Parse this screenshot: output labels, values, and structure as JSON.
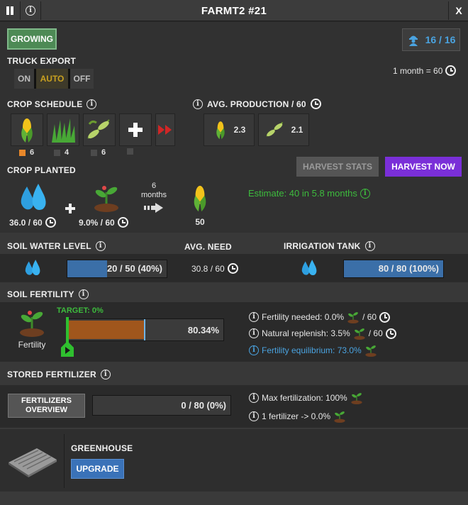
{
  "window": {
    "title": "FARMT2 #21",
    "close_label": "X"
  },
  "status": {
    "label": "GROWING"
  },
  "workers": {
    "value": "16 / 16"
  },
  "truck_export": {
    "label": "TRUCK EXPORT",
    "options": [
      "ON",
      "AUTO",
      "OFF"
    ],
    "selected": "AUTO"
  },
  "time_scale": {
    "text": "1 month = 60"
  },
  "crop_schedule": {
    "label": "CROP SCHEDULE",
    "slots": [
      {
        "crop": "corn",
        "count": "6",
        "active": true
      },
      {
        "crop": "grass",
        "count": "4",
        "active": false
      },
      {
        "crop": "soybean",
        "count": "6",
        "active": false
      },
      {
        "crop": "add",
        "count": "",
        "active": false
      }
    ]
  },
  "avg_production": {
    "label": "AVG. PRODUCTION / 60",
    "items": [
      {
        "crop": "corn",
        "value": "2.3"
      },
      {
        "crop": "soybean",
        "value": "2.1"
      }
    ]
  },
  "crop_planted": {
    "label": "CROP PLANTED",
    "harvest_stats_label": "HARVEST STATS",
    "harvest_now_label": "HARVEST NOW",
    "water_value": "36.0 / 60",
    "fertility_value": "9.0% / 60",
    "months_number": "6",
    "months_word": "months",
    "yield": "50",
    "estimate": "Estimate: 40 in 5.8 months"
  },
  "soil_water": {
    "label": "SOIL WATER LEVEL",
    "bar_text": "20 / 50 (40%)",
    "bar_fraction": 0.4,
    "avg_need_label": "AVG. NEED",
    "avg_need_value": "30.8 / 60",
    "irrigation_label": "IRRIGATION TANK",
    "irrigation_text": "80 / 80 (100%)",
    "irrigation_fraction": 1.0
  },
  "soil_fertility": {
    "label": "SOIL FERTILITY",
    "icon_label": "Fertility",
    "target": "TARGET: 0%",
    "bar_text": "80.34%",
    "fill_fraction": 0.5,
    "marker_fraction": 0.49,
    "needed": "Fertility needed: 0.0%",
    "needed_suffix": "/ 60",
    "replenish": "Natural replenish: 3.5%",
    "replenish_suffix": "/ 60",
    "equilibrium": "Fertility equilibrium: 73.0%"
  },
  "stored_fertilizer": {
    "label": "STORED FERTILIZER",
    "overview_line1": "FERTILIZERS",
    "overview_line2": "OVERVIEW",
    "bar_text": "0 / 80 (0%)",
    "max_fert": "Max fertilization: 100%",
    "per_fert": "1 fertilizer -> 0.0%"
  },
  "greenhouse": {
    "label": "GREENHOUSE",
    "upgrade_label": "UPGRADE"
  },
  "colors": {
    "accent_blue": "#4aa3e0",
    "growing_green": "#4d8a55",
    "harvest_purple": "#7a2fd8",
    "fertility_orange": "#a0561c",
    "water_bar": "#3b6fa8"
  }
}
